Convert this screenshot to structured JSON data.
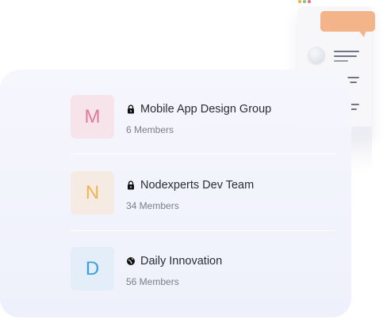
{
  "groups": [
    {
      "initial": "M",
      "name": "Mobile App Design Group",
      "members": "6 Members",
      "privacy_icon": "lock-icon",
      "avatar_bg": "#f6e4ea",
      "avatar_fg": "#e07a97"
    },
    {
      "initial": "N",
      "name": "Nodexperts Dev Team",
      "members": "34 Members",
      "privacy_icon": "lock-icon",
      "avatar_bg": "#f6ebe3",
      "avatar_fg": "#f0b553"
    },
    {
      "initial": "D",
      "name": "Daily Innovation",
      "members": "56 Members",
      "privacy_icon": "globe-icon",
      "avatar_bg": "#e3eef8",
      "avatar_fg": "#3a9ee0"
    }
  ],
  "illustration": {
    "dot_colors": [
      "#f0b04a",
      "#7dc87a",
      "#e86a8a"
    ],
    "bubble_color": "#f3b48a"
  }
}
